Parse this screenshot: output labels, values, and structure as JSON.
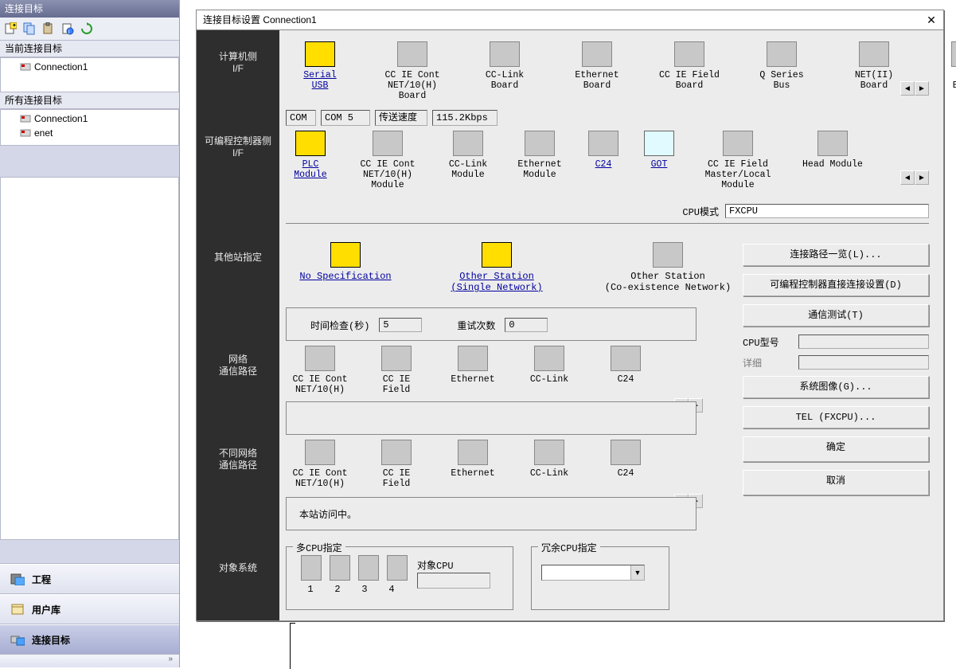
{
  "sidebar": {
    "title": "连接目标",
    "toolbar_icons": [
      "new",
      "copy",
      "paste",
      "props",
      "refresh"
    ],
    "section_current": "当前连接目标",
    "current_items": [
      "Connection1"
    ],
    "section_all": "所有连接目标",
    "all_items": [
      "Connection1",
      "enet"
    ],
    "panels": {
      "project": "工程",
      "userlib": "用户库",
      "target": "连接目标"
    },
    "chevrons": "»"
  },
  "dialog": {
    "title": "连接目标设置 Connection1",
    "row_labels": {
      "pc": "计算机侧\nI/F",
      "plc": "可编程控制器侧 I/F",
      "other": "其他站指定",
      "netpath": "网络\n通信路径",
      "diffnet": "不同网络\n通信路径",
      "targetsys": "对象系统"
    },
    "row_pc": [
      {
        "label": "Serial\nUSB",
        "selected": true,
        "yellow": true
      },
      {
        "label": "CC IE Cont\nNET/10(H)\nBoard"
      },
      {
        "label": "CC-Link\nBoard"
      },
      {
        "label": "Ethernet\nBoard"
      },
      {
        "label": "CC IE Field\nBoard"
      },
      {
        "label": "Q Series\nBus"
      },
      {
        "label": "NET(II)\nBoard"
      },
      {
        "label": "PLC\nBoard"
      }
    ],
    "pc_params": {
      "com_label": "COM",
      "com_value": "COM 5",
      "baud_label": "传送速度",
      "baud_value": "115.2Kbps"
    },
    "row_plc": [
      {
        "label": "PLC\nModule",
        "selected": true,
        "yellow": true
      },
      {
        "label": "CC IE Cont\nNET/10(H)\nModule"
      },
      {
        "label": "CC-Link\nModule"
      },
      {
        "label": "Ethernet\nModule"
      },
      {
        "label": "C24",
        "selected": true
      },
      {
        "label": "GOT",
        "selected": true,
        "got": true
      },
      {
        "label": "CC IE Field\nMaster/Local\nModule"
      },
      {
        "label": "Head Module"
      }
    ],
    "cpu_mode_label": "CPU模式",
    "cpu_mode_value": "FXCPU",
    "row_spec": [
      {
        "label": "No Specification",
        "selected": true,
        "yellow": true
      },
      {
        "label": "Other Station\n(Single Network)",
        "selected": true,
        "yellow": true
      },
      {
        "label": "Other Station\n(Co-existence Network)"
      }
    ],
    "time_check_label": "时间检查(秒)",
    "time_check_value": "5",
    "retry_label": "重试次数",
    "retry_value": "0",
    "row_net": [
      {
        "label": "CC IE Cont\nNET/10(H)"
      },
      {
        "label": "CC IE\nField"
      },
      {
        "label": "Ethernet"
      },
      {
        "label": "CC-Link"
      },
      {
        "label": "C24"
      }
    ],
    "row_diff": [
      {
        "label": "CC IE Cont\nNET/10(H)"
      },
      {
        "label": "CC IE\nField"
      },
      {
        "label": "Ethernet"
      },
      {
        "label": "CC-Link"
      },
      {
        "label": "C24"
      }
    ],
    "status_text": "本站访问中。",
    "buttons": {
      "conn_list": "连接路径一览(L)...",
      "direct": "可编程控制器直接连接设置(D)",
      "comm_test": "通信测试(T)",
      "sys_image": "系统图像(G)...",
      "tel": "TEL (FXCPU)...",
      "ok": "确定",
      "cancel": "取消"
    },
    "kv": {
      "cpu_model_label": "CPU型号",
      "detail_label": "详细"
    },
    "mcpu": {
      "legend": "多CPU指定",
      "nums": [
        "1",
        "2",
        "3",
        "4"
      ],
      "target_cpu_label": "对象CPU"
    },
    "redund": {
      "legend": "冗余CPU指定"
    }
  }
}
